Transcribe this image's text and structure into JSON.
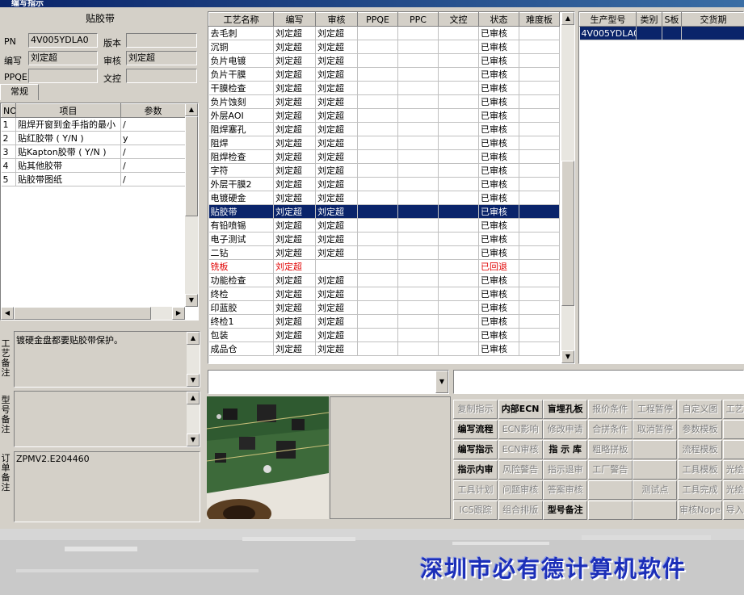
{
  "window": {
    "title": "编写指示"
  },
  "left_panel": {
    "title": "贴胶带",
    "fields": {
      "pn_label": "PN",
      "pn_value": "4V005YDLA0",
      "version_label": "版本",
      "version_value": "",
      "writer_label": "编写",
      "writer_value": "刘定超",
      "reviewer_label": "审核",
      "reviewer_value": "刘定超",
      "ppqe_label": "PPQE",
      "ppqe_value": "",
      "doc_label": "文控",
      "doc_value": ""
    },
    "tab": "常规",
    "param_headers": {
      "no": "NO",
      "item": "项目",
      "param": "参数"
    },
    "params": [
      {
        "no": "1",
        "item": "阻焊开窗到金手指的最小",
        "param": "/"
      },
      {
        "no": "2",
        "item": "贴红胶带 ( Y/N )",
        "param": "y"
      },
      {
        "no": "3",
        "item": "贴Kapton胶带 ( Y/N )",
        "param": "/"
      },
      {
        "no": "4",
        "item": "贴其他胶带",
        "param": "/"
      },
      {
        "no": "5",
        "item": "贴胶带图纸",
        "param": "/"
      }
    ],
    "process_note_label": "工艺备注",
    "process_note": "镀硬金盘都要贴胶带保护。",
    "model_note_label": "型号备注",
    "model_note": "",
    "order_note_label": "订单备注",
    "order_note": "ZPMV2.E204460"
  },
  "process_table": {
    "headers": [
      "工艺名称",
      "编写",
      "审核",
      "PPQE",
      "PPC",
      "文控",
      "状态",
      "难度板"
    ],
    "rows": [
      {
        "name": "去毛刺",
        "writer": "刘定超",
        "reviewer": "刘定超",
        "status": "已审核"
      },
      {
        "name": "沉铜",
        "writer": "刘定超",
        "reviewer": "刘定超",
        "status": "已审核"
      },
      {
        "name": "负片电镀",
        "writer": "刘定超",
        "reviewer": "刘定超",
        "status": "已审核"
      },
      {
        "name": "负片干膜",
        "writer": "刘定超",
        "reviewer": "刘定超",
        "status": "已审核"
      },
      {
        "name": "干膜检查",
        "writer": "刘定超",
        "reviewer": "刘定超",
        "status": "已审核"
      },
      {
        "name": "负片蚀刻",
        "writer": "刘定超",
        "reviewer": "刘定超",
        "status": "已审核"
      },
      {
        "name": "外层AOI",
        "writer": "刘定超",
        "reviewer": "刘定超",
        "status": "已审核"
      },
      {
        "name": "阻焊塞孔",
        "writer": "刘定超",
        "reviewer": "刘定超",
        "status": "已审核"
      },
      {
        "name": "阻焊",
        "writer": "刘定超",
        "reviewer": "刘定超",
        "status": "已审核"
      },
      {
        "name": "阻焊检查",
        "writer": "刘定超",
        "reviewer": "刘定超",
        "status": "已审核"
      },
      {
        "name": "字符",
        "writer": "刘定超",
        "reviewer": "刘定超",
        "status": "已审核"
      },
      {
        "name": "外层干膜2",
        "writer": "刘定超",
        "reviewer": "刘定超",
        "status": "已审核"
      },
      {
        "name": "电镀硬金",
        "writer": "刘定超",
        "reviewer": "刘定超",
        "status": "已审核"
      },
      {
        "name": "贴胶带",
        "writer": "刘定超",
        "reviewer": "刘定超",
        "status": "已审核",
        "selected": true
      },
      {
        "name": "有铅喷锡",
        "writer": "刘定超",
        "reviewer": "刘定超",
        "status": "已审核"
      },
      {
        "name": "电子测试",
        "writer": "刘定超",
        "reviewer": "刘定超",
        "status": "已审核"
      },
      {
        "name": "二钻",
        "writer": "刘定超",
        "reviewer": "刘定超",
        "status": "已审核"
      },
      {
        "name": "铣板",
        "writer": "刘定超",
        "reviewer": "",
        "status": "已回退",
        "returned": true
      },
      {
        "name": "功能检查",
        "writer": "刘定超",
        "reviewer": "刘定超",
        "status": "已审核"
      },
      {
        "name": "终检",
        "writer": "刘定超",
        "reviewer": "刘定超",
        "status": "已审核"
      },
      {
        "name": "印蓝胶",
        "writer": "刘定超",
        "reviewer": "刘定超",
        "status": "已审核"
      },
      {
        "name": "终检1",
        "writer": "刘定超",
        "reviewer": "刘定超",
        "status": "已审核"
      },
      {
        "name": "包装",
        "writer": "刘定超",
        "reviewer": "刘定超",
        "status": "已审核"
      },
      {
        "name": "成品仓",
        "writer": "刘定超",
        "reviewer": "刘定超",
        "status": "已审核"
      }
    ]
  },
  "model_table": {
    "headers": [
      "生产型号",
      "类别",
      "S板",
      "交货期"
    ],
    "rows": [
      {
        "model": "4V005YDLA0"
      }
    ]
  },
  "buttons": [
    [
      "复制指示",
      "内部ECN",
      "盲埋孔板",
      "报价条件",
      "工程暂停",
      "自定义图",
      "工艺"
    ],
    [
      "编写流程",
      "ECN影响",
      "修改申请",
      "合拼条件",
      "取消暂停",
      "参数模板",
      ""
    ],
    [
      "编写指示",
      "ECN审核",
      "指 示 库",
      "粗略拼板",
      "",
      "流程模板",
      ""
    ],
    [
      "指示内审",
      "风险警告",
      "指示退审",
      "工厂警告",
      "",
      "工具模板",
      "光绘"
    ],
    [
      "工具计划",
      "问题审核",
      "答案审核",
      "",
      "测试点",
      "工具完成",
      "光绘"
    ],
    [
      "ICS跟踪",
      "组合排版",
      "型号备注",
      "",
      "",
      "审核Nope",
      "导入"
    ]
  ],
  "footer": {
    "brand": "深圳市必有德计算机软件"
  },
  "colors": {
    "selection": "#0a246a",
    "returned": "#e00000",
    "brand": "#1c2fb8"
  }
}
